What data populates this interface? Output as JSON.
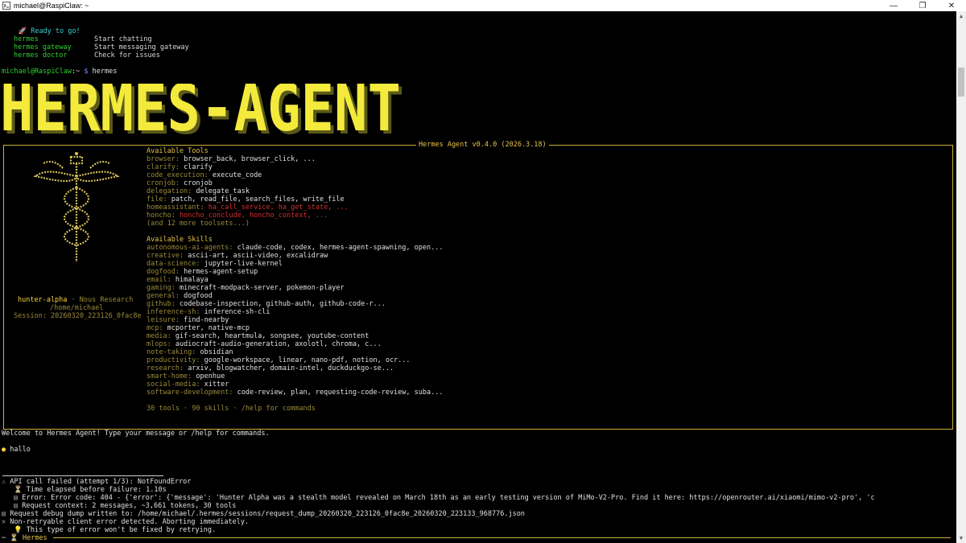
{
  "window": {
    "title": "michael@RaspiClaw: ~",
    "minimize": "—",
    "maximize": "❐",
    "close": "✕"
  },
  "ready": {
    "icon": "rocket-icon",
    "text": "Ready to go!"
  },
  "commands": [
    {
      "cmd": "hermes",
      "desc": "Start chatting"
    },
    {
      "cmd": "hermes gateway",
      "desc": "Start messaging gateway"
    },
    {
      "cmd": "hermes doctor",
      "desc": "Check for issues"
    }
  ],
  "prompt": {
    "user": "michael@RaspiClaw",
    "path": ":~",
    "symbol": "$",
    "command": "hermes"
  },
  "banner": {
    "text": "HERMES-AGENT"
  },
  "box_title": "Hermes Agent v0.4.0 (2026.3.18)",
  "model": {
    "name": "hunter-alpha",
    "sep": "·",
    "provider": "Nous Research",
    "cwd": "/home/michael",
    "session": "Session: 20260320_223126_0fac8e"
  },
  "tools_header": "Available Tools",
  "tools": [
    {
      "k": "browser:",
      "v": "browser_back, browser_click, ..."
    },
    {
      "k": "clarify:",
      "v": "clarify"
    },
    {
      "k": "code_execution:",
      "v": "execute_code"
    },
    {
      "k": "cronjob:",
      "v": "cronjob"
    },
    {
      "k": "delegation:",
      "v": "delegate_task"
    },
    {
      "k": "file:",
      "v": "patch, read_file, search_files, write_file"
    },
    {
      "k": "homeassistant:",
      "v": "ha_call_service, ha_get_state, ...",
      "red": true
    },
    {
      "k": "honcho:",
      "v": "honcho_conclude, honcho_context, ...",
      "red": true
    }
  ],
  "tools_more": "(and 12 more toolsets...)",
  "skills_header": "Available Skills",
  "skills": [
    {
      "k": "autonomous-ai-agents:",
      "v": "claude-code, codex, hermes-agent-spawning, open..."
    },
    {
      "k": "creative:",
      "v": "ascii-art, ascii-video, excalidraw"
    },
    {
      "k": "data-science:",
      "v": "jupyter-live-kernel"
    },
    {
      "k": "dogfood:",
      "v": "hermes-agent-setup"
    },
    {
      "k": "email:",
      "v": "himalaya"
    },
    {
      "k": "gaming:",
      "v": "minecraft-modpack-server, pokemon-player"
    },
    {
      "k": "general:",
      "v": "dogfood"
    },
    {
      "k": "github:",
      "v": "codebase-inspection, github-auth, github-code-r..."
    },
    {
      "k": "inference-sh:",
      "v": "inference-sh-cli"
    },
    {
      "k": "leisure:",
      "v": "find-nearby"
    },
    {
      "k": "mcp:",
      "v": "mcporter, native-mcp"
    },
    {
      "k": "media:",
      "v": "gif-search, heartmula, songsee, youtube-content"
    },
    {
      "k": "mlops:",
      "v": "audiocraft-audio-generation, axolotl, chroma, c..."
    },
    {
      "k": "note-taking:",
      "v": "obsidian"
    },
    {
      "k": "productivity:",
      "v": "google-workspace, linear, nano-pdf, notion, ocr..."
    },
    {
      "k": "research:",
      "v": "arxiv, blogwatcher, domain-intel, duckduckgo-se..."
    },
    {
      "k": "smart-home:",
      "v": "openhue"
    },
    {
      "k": "social-media:",
      "v": "xitter"
    },
    {
      "k": "software-development:",
      "v": "code-review, plan, requesting-code-review, suba..."
    }
  ],
  "summary": "30 tools · 90 skills · /help for commands",
  "welcome": "Welcome to Hermes Agent! Type your message or /help for commands.",
  "user_msg": {
    "bullet": "●",
    "text": "hallo"
  },
  "errors": [
    {
      "icon": "warning-icon",
      "glyph": "⚠",
      "text": "API call failed (attempt 1/3): NotFoundError",
      "indent": 0
    },
    {
      "icon": "hourglass-icon",
      "glyph": "⏳",
      "text": "Time elapsed before failure: 1.10s",
      "indent": 1
    },
    {
      "icon": "document-icon",
      "glyph": "▤",
      "text": "Error: Error code: 404 - {'error': {'message': 'Hunter Alpha was a stealth model revealed on March 18th as an early testing version of MiMo-V2-Pro. Find it here: https://openrouter.ai/xiaomi/mimo-v2-pro', 'c",
      "indent": 1
    },
    {
      "icon": "document-icon",
      "glyph": "▤",
      "text": "Request context: 2 messages, ~3,661 tokens, 30 tools",
      "indent": 1
    },
    {
      "icon": "clipboard-icon",
      "glyph": "▤",
      "text": "Request debug dump written to: /home/michael/.hermes/sessions/request_dump_20260320_223126_0fac8e_20260320_223133_968776.json",
      "indent": 0
    },
    {
      "icon": "cross-icon",
      "glyph": "✕",
      "text": "Non-retryable client error detected. Aborting immediately.",
      "indent": 0
    },
    {
      "icon": "lightbulb-icon",
      "glyph": "💡",
      "text": "This type of error won't be fixed by retrying.",
      "indent": 1
    }
  ],
  "status_line": {
    "prefix": "─",
    "glyph": "⏳",
    "label": "Hermes"
  }
}
